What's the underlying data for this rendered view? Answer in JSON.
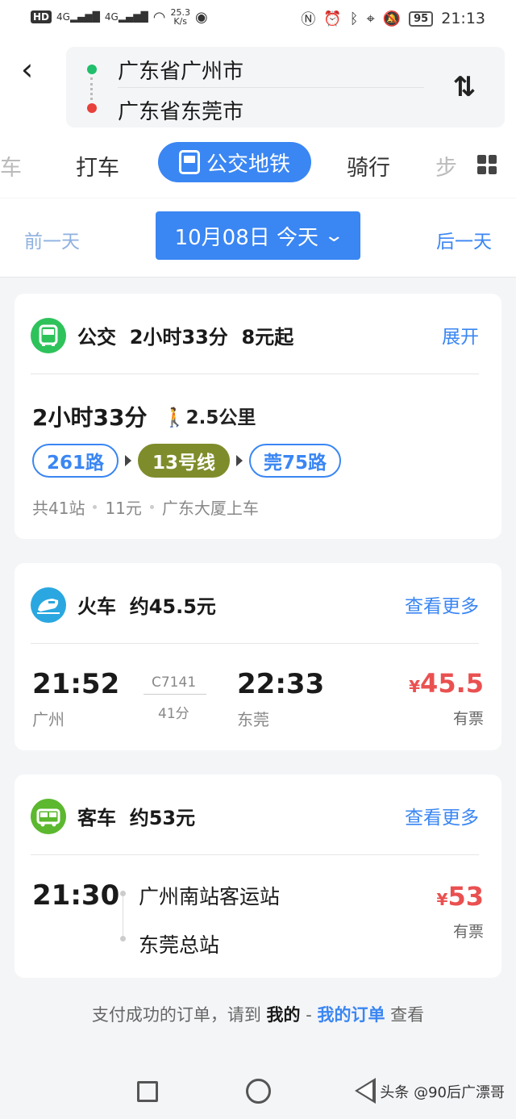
{
  "status_bar": {
    "hd": "HD",
    "net1": "4G",
    "net2": "4G",
    "speed_value": "25.3",
    "speed_unit": "K/s",
    "battery": "95",
    "time": "21:13"
  },
  "route": {
    "from": "广东省广州市",
    "to": "广东省东莞市"
  },
  "tabs": {
    "partial_left": "车",
    "taxi": "打车",
    "transit": "公交地铁",
    "bike": "骑行",
    "partial_right": "步"
  },
  "date": {
    "prev": "前一天",
    "current": "10月08日 今天",
    "next": "后一天"
  },
  "bus_card": {
    "title": "公交  2小时33分  8元起",
    "expand": "展开",
    "duration": "2小时33分",
    "walk": "2.5公里",
    "lines": [
      "261路",
      "13号线",
      "莞75路"
    ],
    "stops": "共41站",
    "fare": "11元",
    "board": "广东大厦上车"
  },
  "train_card": {
    "title": "火车  约45.5元",
    "more": "查看更多",
    "depart_time": "21:52",
    "depart_city": "广州",
    "train_no": "C7141",
    "duration": "41分",
    "arrive_time": "22:33",
    "arrive_city": "东莞",
    "currency": "¥",
    "price": "45.5",
    "ticket": "有票"
  },
  "coach_card": {
    "title": "客车  约53元",
    "more": "查看更多",
    "depart_time": "21:30",
    "from_station": "广州南站客运站",
    "to_station": "东莞总站",
    "currency": "¥",
    "price": "53",
    "ticket": "有票"
  },
  "footer": {
    "prefix": "支付成功的订单，请到 ",
    "mine": "我的",
    "sep": " - ",
    "orders": "我的订单",
    "suffix": " 查看"
  },
  "watermark": "头条 @90后广漂哥",
  "colors": {
    "accent": "#3a86f3",
    "price": "#ea5050",
    "bus_icon": "#2ec25b",
    "train_icon": "#2aa7e0",
    "coach_icon": "#5cb82e",
    "metro_line": "#7f8c2b"
  }
}
